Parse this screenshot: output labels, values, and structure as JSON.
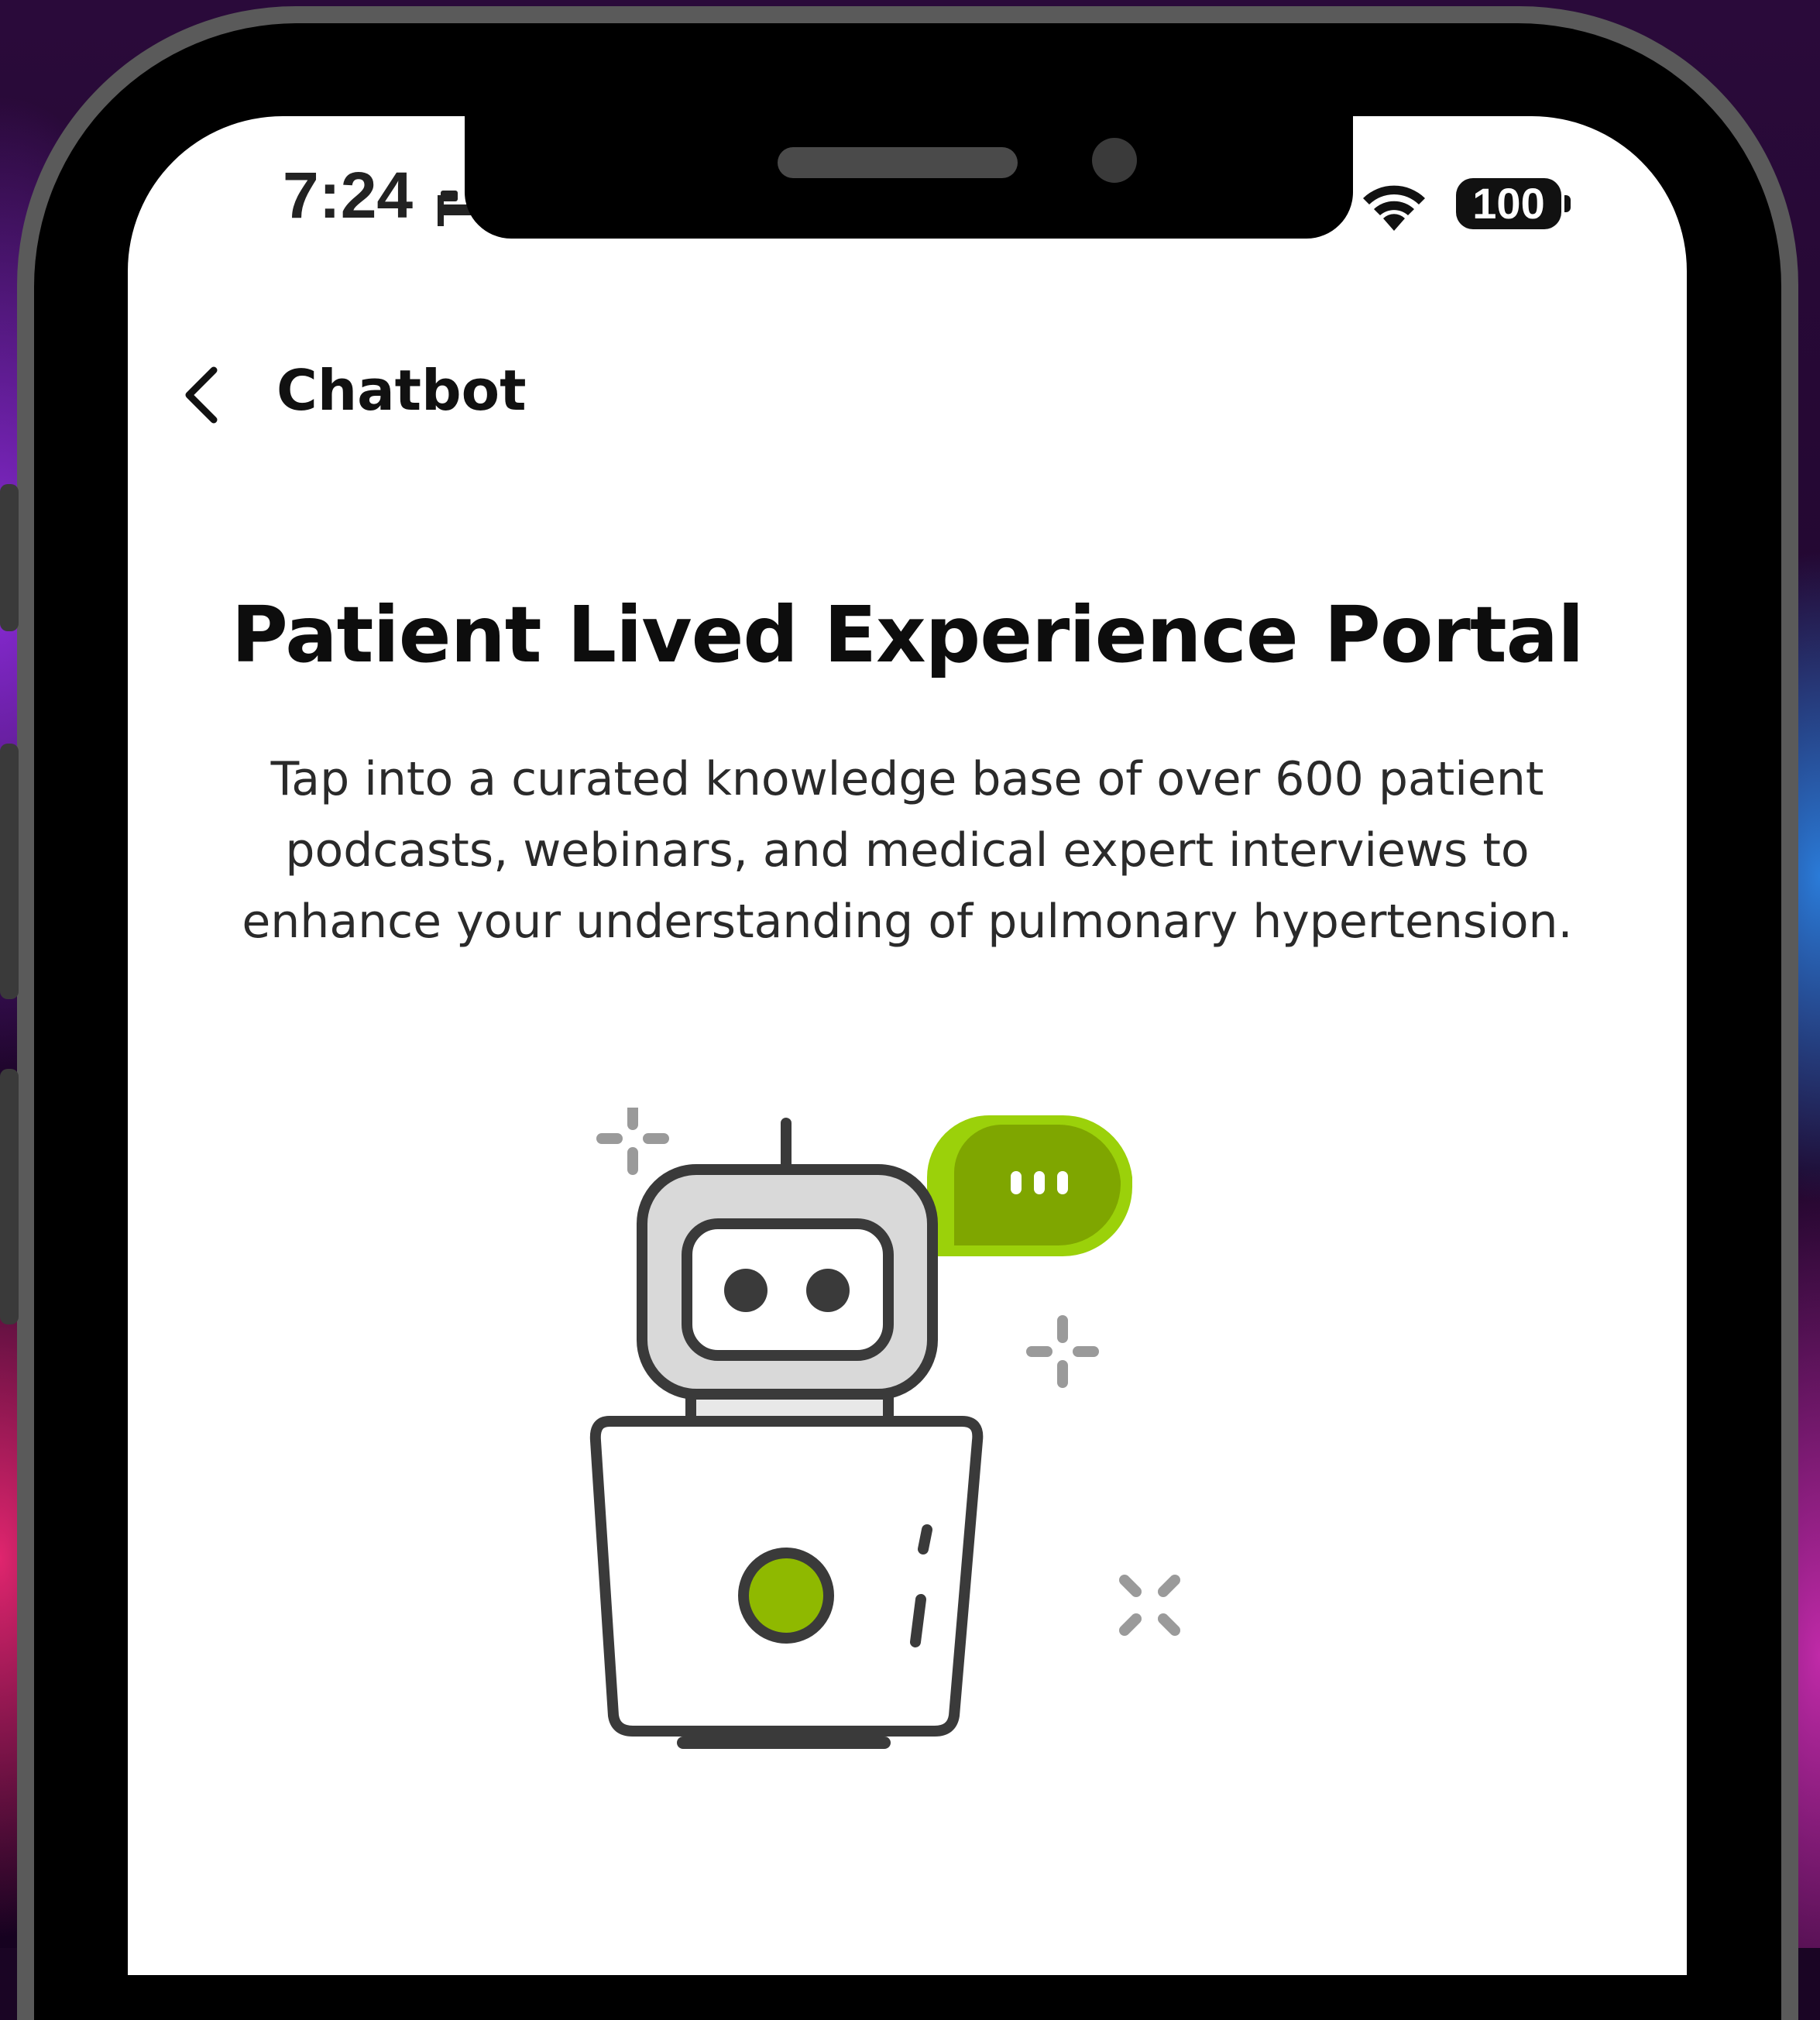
{
  "status_bar": {
    "time": "7:24",
    "battery": "100"
  },
  "header": {
    "title": "Chatbot"
  },
  "main": {
    "title": "Patient Lived Experience Portal",
    "description": "Tap into a curated knowledge base of over 600 patient podcasts, webinars, and medical expert interviews to enhance your understanding of pulmonary hypertension."
  },
  "colors": {
    "accent_green": "#8fb900",
    "text_dark": "#111111",
    "robot_gray": "#3a3a3a"
  }
}
